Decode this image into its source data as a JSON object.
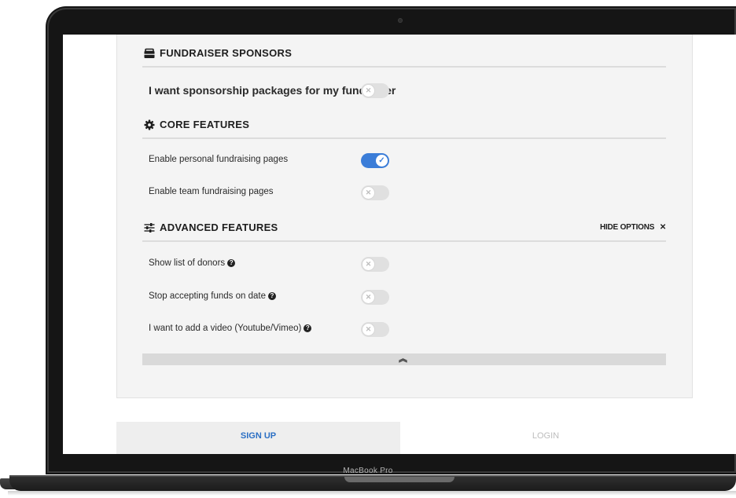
{
  "device": {
    "label": "MacBook Pro"
  },
  "sections": {
    "sponsors": {
      "title": "FUNDRAISER SPONSORS",
      "icon": "briefcase-icon",
      "rows": [
        {
          "label": "I want sponsorship packages for my fundraiser",
          "enabled": false
        }
      ]
    },
    "core": {
      "title": "CORE FEATURES",
      "icon": "gear-icon",
      "rows": [
        {
          "label": "Enable personal fundraising pages",
          "enabled": true
        },
        {
          "label": "Enable team fundraising pages",
          "enabled": false
        }
      ]
    },
    "advanced": {
      "title": "ADVANCED FEATURES",
      "icon": "sliders-icon",
      "hide_options_label": "HIDE OPTIONS",
      "hide_options_icon": "close-icon",
      "rows": [
        {
          "label": "Show list of donors",
          "enabled": false,
          "help": true
        },
        {
          "label": "Stop accepting funds on date",
          "enabled": false,
          "help": true
        },
        {
          "label": "I want to add a video (Youtube/Vimeo)",
          "enabled": false,
          "help": true
        }
      ]
    }
  },
  "collapse": {
    "icon": "double-chevron-up-icon"
  },
  "tabs": [
    {
      "label": "SIGN UP",
      "active": true
    },
    {
      "label": "LOGIN",
      "active": false
    }
  ],
  "colors": {
    "accent": "#3b7dd8",
    "tab_active_text": "#2b6fc4",
    "panel_bg": "#f4f4f4",
    "toggle_off": "#e0e0e0"
  }
}
